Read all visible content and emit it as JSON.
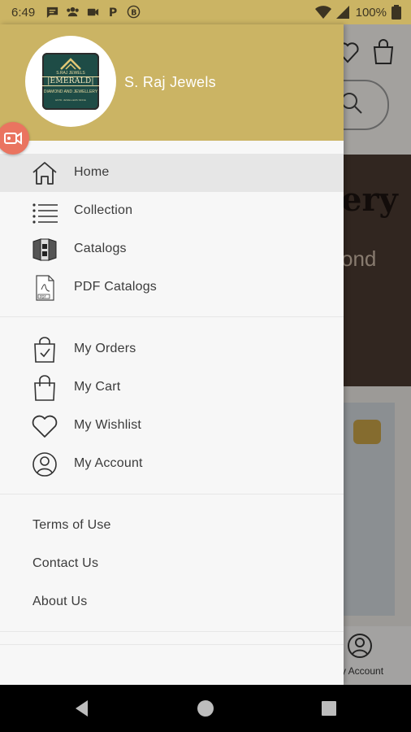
{
  "status_bar": {
    "time": "6:49",
    "battery": "100%",
    "left_icons": [
      "chat-icon",
      "group-icon",
      "video-icon",
      "parking-icon",
      "b-app-icon"
    ],
    "right_icons": [
      "wifi-icon",
      "signal-icon",
      "battery-icon"
    ]
  },
  "background_app": {
    "banner_text_fragment": "ery",
    "banner_text_fragment2": "ond",
    "bottom_nav_label_fragment": "y Account"
  },
  "drawer": {
    "header": {
      "store_name": "S. Raj Jewels",
      "logo": {
        "top_text": "S.RAJ JEWELS",
        "name": "|EMERALD|",
        "sub_text": "DIAMOND AND JEWELLERY",
        "foot_text": "ESTD. JEWELLERS SINCE"
      }
    },
    "primary_menu": [
      {
        "label": "Home",
        "icon": "home-icon",
        "active": true
      },
      {
        "label": "Collection",
        "icon": "list-icon",
        "active": false
      },
      {
        "label": "Catalogs",
        "icon": "catalog-icon",
        "active": false
      },
      {
        "label": "PDF Catalogs",
        "icon": "pdf-icon",
        "active": false
      }
    ],
    "account_menu": [
      {
        "label": "My Orders",
        "icon": "orders-bag-icon"
      },
      {
        "label": "My Cart",
        "icon": "cart-bag-icon"
      },
      {
        "label": "My Wishlist",
        "icon": "heart-icon"
      },
      {
        "label": "My Account",
        "icon": "account-icon"
      }
    ],
    "info_links": [
      "Terms of Use",
      "Contact Us",
      "About Us"
    ]
  },
  "colors": {
    "header": "#cbb464",
    "drawer_bg": "#f7f7f7",
    "active_item": "#e6e6e6",
    "record_button": "#ea7460"
  },
  "system_nav": [
    "back-icon",
    "home-circle-icon",
    "recents-icon"
  ]
}
